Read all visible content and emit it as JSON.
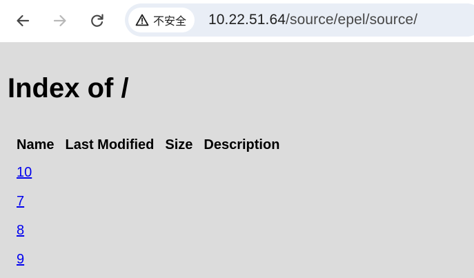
{
  "browser": {
    "toolbar": {
      "back_icon": "arrow-left-icon",
      "forward_icon": "arrow-right-icon",
      "reload_icon": "reload-icon"
    },
    "address_bar": {
      "security_label": "不安全",
      "security_icon": "warning-triangle-icon",
      "url_host": "10.22.51.64",
      "url_path": "/source/epel/source/"
    }
  },
  "page": {
    "title": "Index of /",
    "table": {
      "headers": [
        "Name",
        "Last Modified",
        "Size",
        "Description"
      ],
      "rows": [
        {
          "name": "10",
          "last_modified": "",
          "size": "",
          "description": ""
        },
        {
          "name": "7",
          "last_modified": "",
          "size": "",
          "description": ""
        },
        {
          "name": "8",
          "last_modified": "",
          "size": "",
          "description": ""
        },
        {
          "name": "9",
          "last_modified": "",
          "size": "",
          "description": ""
        }
      ]
    }
  },
  "colors": {
    "page_background": "#dcdcdc",
    "link": "#0000ee",
    "omnibox_background": "#e9eef6"
  }
}
